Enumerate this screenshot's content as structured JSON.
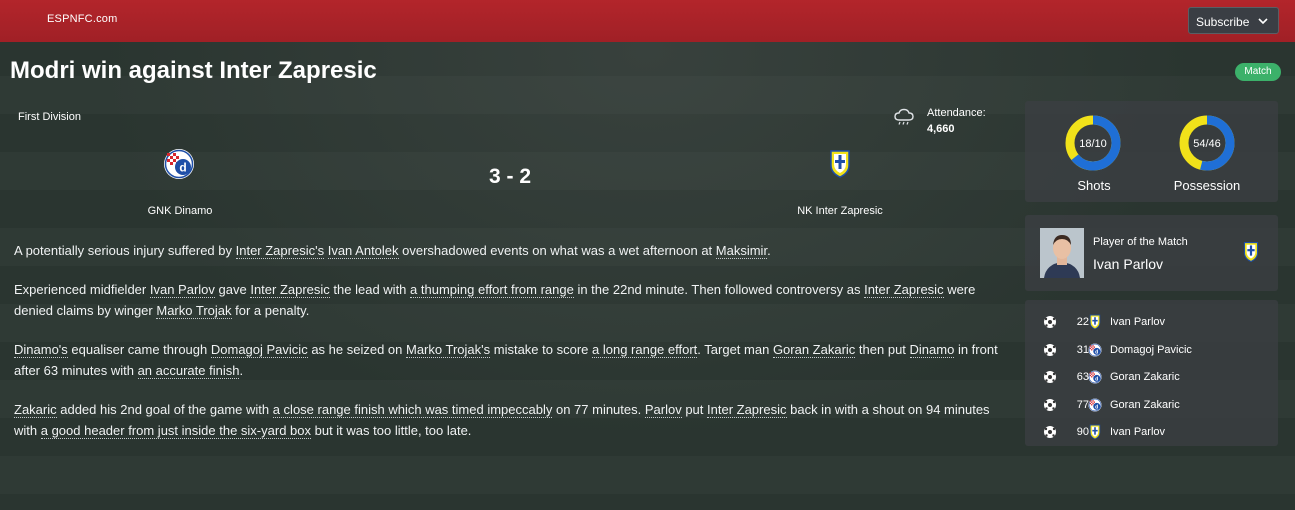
{
  "topbar": {
    "brand": "ESPNFC.com",
    "subscribe_label": "Subscribe",
    "accent": "#b3252b"
  },
  "headline": "Modri win against Inter Zapresic",
  "tag": "Match",
  "match": {
    "competition": "First Division",
    "attendance_label": "Attendance:",
    "attendance_value": "4,660",
    "weather_icon": "rain-cloud-icon",
    "home_team": "GNK Dinamo",
    "away_team": "NK Inter Zapresic",
    "score": "3 - 2"
  },
  "report": {
    "p1": [
      {
        "t": "A potentially serious injury suffered by "
      },
      {
        "t": "Inter Zapresic's",
        "u": true
      },
      {
        "t": " "
      },
      {
        "t": "Ivan Antolek",
        "u": true
      },
      {
        "t": " overshadowed events on what was a wet afternoon at "
      },
      {
        "t": "Maksimir",
        "u": true
      },
      {
        "t": "."
      }
    ],
    "p2": [
      {
        "t": "Experienced midfielder "
      },
      {
        "t": "Ivan Parlov",
        "u": true
      },
      {
        "t": " gave "
      },
      {
        "t": "Inter Zapresic",
        "u": true
      },
      {
        "t": " the lead with "
      },
      {
        "t": "a thumping effort from range",
        "u": true
      },
      {
        "t": " in the 22nd minute. Then followed controversy as "
      },
      {
        "t": "Inter Zapresic",
        "u": true
      },
      {
        "t": " were denied claims by winger "
      },
      {
        "t": "Marko Trojak",
        "u": true
      },
      {
        "t": " for a penalty."
      }
    ],
    "p3": [
      {
        "t": "Dinamo's",
        "u": true
      },
      {
        "t": " equaliser came through "
      },
      {
        "t": "Domagoj Pavicic",
        "u": true
      },
      {
        "t": " as he seized on "
      },
      {
        "t": "Marko Trojak's",
        "u": true
      },
      {
        "t": " mistake to score "
      },
      {
        "t": "a long range effort",
        "u": true
      },
      {
        "t": ". Target man "
      },
      {
        "t": "Goran Zakaric",
        "u": true
      },
      {
        "t": " then put "
      },
      {
        "t": "Dinamo",
        "u": true
      },
      {
        "t": " in front after 63 minutes with "
      },
      {
        "t": "an accurate finish",
        "u": true
      },
      {
        "t": "."
      }
    ],
    "p4": [
      {
        "t": "Zakaric",
        "u": true
      },
      {
        "t": " added his 2nd goal of the game with "
      },
      {
        "t": "a close range finish which was timed impeccably",
        "u": true
      },
      {
        "t": " on 77 minutes. "
      },
      {
        "t": "Parlov",
        "u": true
      },
      {
        "t": " put "
      },
      {
        "t": "Inter Zapresic",
        "u": true
      },
      {
        "t": " back in with a shout on 94 minutes with "
      },
      {
        "t": "a good header from just inside the six-yard box",
        "u": true
      },
      {
        "t": " but it was too little, too late."
      }
    ]
  },
  "stats": {
    "shots": {
      "label": "Shots",
      "text": "18/10",
      "home": 18,
      "away": 10
    },
    "possession": {
      "label": "Possession",
      "text": "54/46",
      "home": 54,
      "away": 46
    },
    "home_color": "#1f6fd6",
    "away_color": "#f1e21a"
  },
  "potm": {
    "label": "Player of the Match",
    "name": "Ivan Parlov"
  },
  "goals": [
    {
      "minute": "22",
      "scorer": "Ivan Parlov",
      "team": "away"
    },
    {
      "minute": "31",
      "scorer": "Domagoj Pavicic",
      "team": "home"
    },
    {
      "minute": "63",
      "scorer": "Goran Zakaric",
      "team": "home"
    },
    {
      "minute": "77",
      "scorer": "Goran Zakaric",
      "team": "home"
    },
    {
      "minute": "90",
      "scorer": "Ivan Parlov",
      "team": "away"
    }
  ]
}
